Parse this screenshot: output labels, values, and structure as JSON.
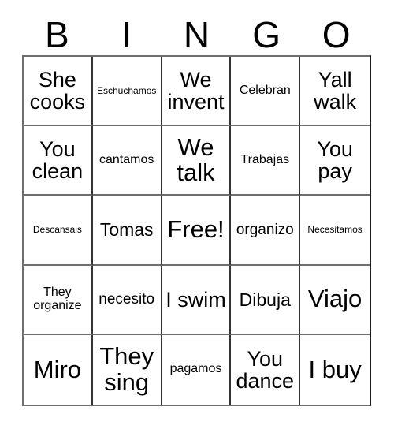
{
  "card": {
    "type": "bingo-card",
    "columns": 5,
    "rows": 5,
    "header": {
      "letters": [
        "B",
        "I",
        "N",
        "G",
        "O"
      ]
    },
    "colors": {
      "text": "#000000",
      "background": "#ffffff",
      "grid_border": "#333333",
      "outer_border": "#6e6e6e"
    },
    "free_space": {
      "label": "Free!",
      "row": 3,
      "column": 3
    },
    "cells": [
      {
        "text": "She cooks",
        "size": "fs-xl",
        "row": 1,
        "col": 1
      },
      {
        "text": "Eschuchamos",
        "size": "fs-xs",
        "row": 1,
        "col": 2
      },
      {
        "text": "We invent",
        "size": "fs-xl",
        "row": 1,
        "col": 3
      },
      {
        "text": "Celebran",
        "size": "fs-s",
        "row": 1,
        "col": 4
      },
      {
        "text": "Yall walk",
        "size": "fs-xl",
        "row": 1,
        "col": 5
      },
      {
        "text": "You clean",
        "size": "fs-xl",
        "row": 2,
        "col": 1
      },
      {
        "text": "cantamos",
        "size": "fs-s",
        "row": 2,
        "col": 2
      },
      {
        "text": "We talk",
        "size": "fs-xxl",
        "row": 2,
        "col": 3
      },
      {
        "text": "Trabajas",
        "size": "fs-s",
        "row": 2,
        "col": 4
      },
      {
        "text": "You pay",
        "size": "fs-xl",
        "row": 2,
        "col": 5
      },
      {
        "text": "Descansais",
        "size": "fs-xs",
        "row": 3,
        "col": 1
      },
      {
        "text": "Tomas",
        "size": "fs-l",
        "row": 3,
        "col": 2
      },
      {
        "text": "Free!",
        "size": "fs-xxl",
        "row": 3,
        "col": 3
      },
      {
        "text": "organizo",
        "size": "fs-m",
        "row": 3,
        "col": 4
      },
      {
        "text": "Necesitamos",
        "size": "fs-xs",
        "row": 3,
        "col": 5
      },
      {
        "text": "They organize",
        "size": "fs-s",
        "row": 4,
        "col": 1
      },
      {
        "text": "necesito",
        "size": "fs-m",
        "row": 4,
        "col": 2
      },
      {
        "text": "I swim",
        "size": "fs-xl",
        "row": 4,
        "col": 3
      },
      {
        "text": "Dibuja",
        "size": "fs-l",
        "row": 4,
        "col": 4
      },
      {
        "text": "Viajo",
        "size": "fs-xxl",
        "row": 4,
        "col": 5
      },
      {
        "text": "Miro",
        "size": "fs-xxl",
        "row": 5,
        "col": 1
      },
      {
        "text": "They sing",
        "size": "fs-xxl",
        "row": 5,
        "col": 2
      },
      {
        "text": "pagamos",
        "size": "fs-s",
        "row": 5,
        "col": 3
      },
      {
        "text": "You dance",
        "size": "fs-xl",
        "row": 5,
        "col": 4
      },
      {
        "text": "I buy",
        "size": "fs-xxl",
        "row": 5,
        "col": 5
      }
    ]
  }
}
